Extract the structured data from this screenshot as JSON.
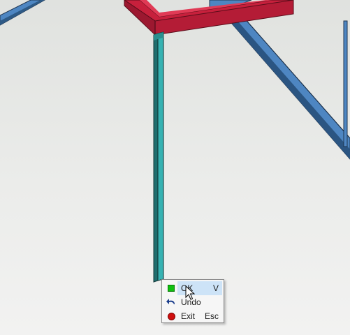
{
  "viewport": {
    "background_color": "#e6e7e5"
  },
  "scene": {
    "beam_red_color": "#c7203c",
    "column_teal_color": "#36b2b2",
    "brace_blue_color": "#4e86c2"
  },
  "context_menu": {
    "items": [
      {
        "label": "OK",
        "shortcut": "V",
        "icon": "green-square-icon",
        "icon_color": "#10c010",
        "highlighted": true
      },
      {
        "label": "Undo",
        "shortcut": "",
        "icon": "undo-arrow-icon",
        "icon_color": "#1a3d8c",
        "highlighted": false
      },
      {
        "label": "Exit",
        "shortcut": "Esc",
        "icon": "red-dot-icon",
        "icon_color": "#d01010",
        "highlighted": false
      }
    ]
  },
  "cursor": {
    "icon": "mouse-pointer-icon"
  }
}
